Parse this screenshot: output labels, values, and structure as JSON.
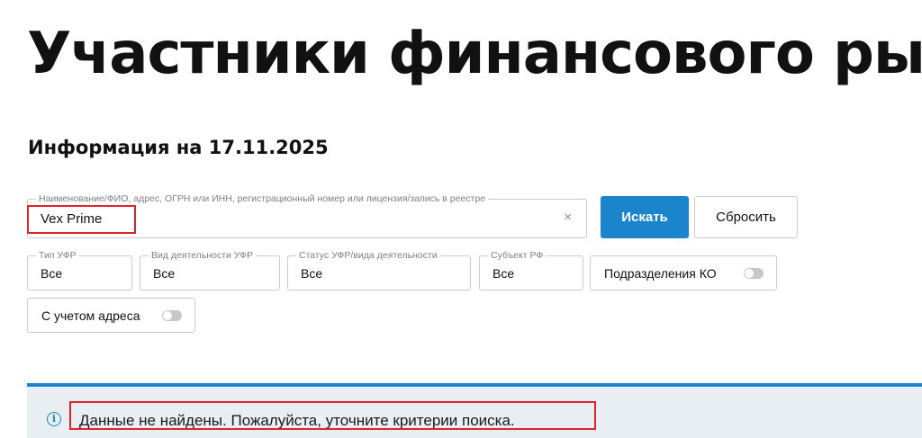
{
  "page": {
    "title": "Участники финансового рынка",
    "info_date": "Информация на 17.11.2025"
  },
  "search": {
    "label": "Наименование/ФИО, адрес, ОГРН или ИНН, регистрационный номер или лицензия/запись в реестре",
    "value": "Vex Prime",
    "clear_symbol": "×",
    "search_button": "Искать",
    "reset_button": "Сбросить"
  },
  "filters": [
    {
      "label": "Тип УФР",
      "value": "Все"
    },
    {
      "label": "Вид деятельности УФР",
      "value": "Все"
    },
    {
      "label": "Статус УФР/вида деятельности",
      "value": "Все"
    },
    {
      "label": "Субъект РФ",
      "value": "Все"
    }
  ],
  "toggles": {
    "ko_divisions": {
      "label": "Подразделения КО",
      "on": false
    },
    "with_address": {
      "label": "С учетом адреса",
      "on": false
    }
  },
  "result": {
    "icon": "info-icon",
    "message": "Данные не найдены. Пожалуйста, уточните критерии поиска."
  },
  "colors": {
    "accent": "#1a84cc",
    "highlight": "#e0242c",
    "info_background": "#e9eef3"
  }
}
